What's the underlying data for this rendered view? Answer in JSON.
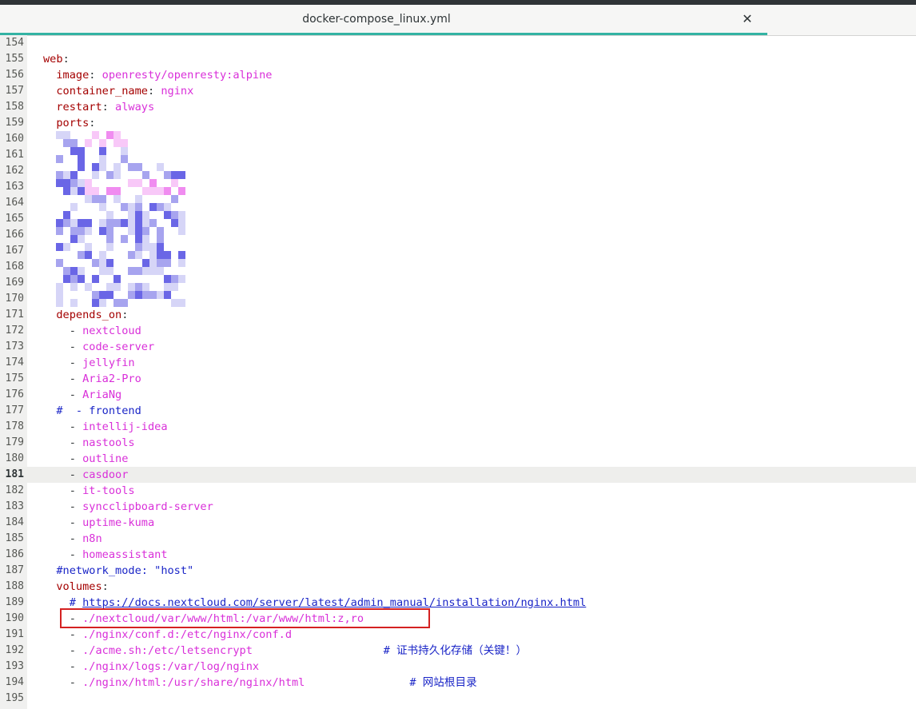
{
  "tab": {
    "title": "docker-compose_linux.yml"
  },
  "current_line": 181,
  "lines": [
    {
      "n": "154",
      "segs": []
    },
    {
      "n": "155",
      "segs": [
        {
          "t": "web",
          "c": "k"
        },
        {
          "t": ":",
          "c": "p"
        }
      ]
    },
    {
      "n": "156",
      "segs": [
        {
          "t": "  image",
          "c": "k"
        },
        {
          "t": ": ",
          "c": "p"
        },
        {
          "t": "openresty/openresty:alpine",
          "c": "v"
        }
      ]
    },
    {
      "n": "157",
      "segs": [
        {
          "t": "  container_name",
          "c": "k"
        },
        {
          "t": ": ",
          "c": "p"
        },
        {
          "t": "nginx",
          "c": "v"
        }
      ]
    },
    {
      "n": "158",
      "segs": [
        {
          "t": "  restart",
          "c": "k"
        },
        {
          "t": ": ",
          "c": "p"
        },
        {
          "t": "always",
          "c": "v"
        }
      ]
    },
    {
      "n": "159",
      "segs": [
        {
          "t": "  ports",
          "c": "k"
        },
        {
          "t": ":",
          "c": "p"
        }
      ]
    },
    {
      "n": "160",
      "segs": []
    },
    {
      "n": "161",
      "segs": []
    },
    {
      "n": "162",
      "segs": []
    },
    {
      "n": "163",
      "segs": []
    },
    {
      "n": "164",
      "segs": []
    },
    {
      "n": "165",
      "segs": []
    },
    {
      "n": "166",
      "segs": []
    },
    {
      "n": "167",
      "segs": []
    },
    {
      "n": "168",
      "segs": []
    },
    {
      "n": "169",
      "segs": []
    },
    {
      "n": "170",
      "segs": []
    },
    {
      "n": "171",
      "segs": [
        {
          "t": "  depends_on",
          "c": "k"
        },
        {
          "t": ":",
          "c": "p"
        }
      ]
    },
    {
      "n": "172",
      "segs": [
        {
          "t": "    - ",
          "c": "p"
        },
        {
          "t": "nextcloud",
          "c": "v"
        }
      ]
    },
    {
      "n": "173",
      "segs": [
        {
          "t": "    - ",
          "c": "p"
        },
        {
          "t": "code-server",
          "c": "v"
        }
      ]
    },
    {
      "n": "174",
      "segs": [
        {
          "t": "    - ",
          "c": "p"
        },
        {
          "t": "jellyfin",
          "c": "v"
        }
      ]
    },
    {
      "n": "175",
      "segs": [
        {
          "t": "    - ",
          "c": "p"
        },
        {
          "t": "Aria2-Pro",
          "c": "v"
        }
      ]
    },
    {
      "n": "176",
      "segs": [
        {
          "t": "    - ",
          "c": "p"
        },
        {
          "t": "AriaNg",
          "c": "v"
        }
      ]
    },
    {
      "n": "177",
      "segs": [
        {
          "t": "  #  - frontend",
          "c": "c"
        }
      ]
    },
    {
      "n": "178",
      "segs": [
        {
          "t": "    - ",
          "c": "p"
        },
        {
          "t": "intellij-idea",
          "c": "v"
        }
      ]
    },
    {
      "n": "179",
      "segs": [
        {
          "t": "    - ",
          "c": "p"
        },
        {
          "t": "nastools",
          "c": "v"
        }
      ]
    },
    {
      "n": "180",
      "segs": [
        {
          "t": "    - ",
          "c": "p"
        },
        {
          "t": "outline",
          "c": "v"
        }
      ]
    },
    {
      "n": "181",
      "segs": [
        {
          "t": "    - ",
          "c": "p"
        },
        {
          "t": "casdoor",
          "c": "v"
        }
      ]
    },
    {
      "n": "182",
      "segs": [
        {
          "t": "    - ",
          "c": "p"
        },
        {
          "t": "it-tools",
          "c": "v"
        }
      ]
    },
    {
      "n": "183",
      "segs": [
        {
          "t": "    - ",
          "c": "p"
        },
        {
          "t": "syncclipboard-server",
          "c": "v"
        }
      ]
    },
    {
      "n": "184",
      "segs": [
        {
          "t": "    - ",
          "c": "p"
        },
        {
          "t": "uptime-kuma",
          "c": "v"
        }
      ]
    },
    {
      "n": "185",
      "segs": [
        {
          "t": "    - ",
          "c": "p"
        },
        {
          "t": "n8n",
          "c": "v"
        }
      ]
    },
    {
      "n": "186",
      "segs": [
        {
          "t": "    - ",
          "c": "p"
        },
        {
          "t": "homeassistant",
          "c": "v"
        }
      ]
    },
    {
      "n": "187",
      "segs": [
        {
          "t": "  #network_mode: \"host\"",
          "c": "c"
        }
      ]
    },
    {
      "n": "188",
      "segs": [
        {
          "t": "  volumes",
          "c": "k"
        },
        {
          "t": ":",
          "c": "p"
        }
      ]
    },
    {
      "n": "189",
      "segs": [
        {
          "t": "    # ",
          "c": "c"
        },
        {
          "t": "https://docs.nextcloud.com/server/latest/admin_manual/installation/nginx.html",
          "c": "u"
        }
      ]
    },
    {
      "n": "190",
      "segs": [
        {
          "t": "    - ",
          "c": "p"
        },
        {
          "t": "./nextcloud/var/www/html:/var/www/html:z,ro",
          "c": "v"
        }
      ]
    },
    {
      "n": "191",
      "segs": [
        {
          "t": "    - ",
          "c": "p"
        },
        {
          "t": "./nginx/conf.d:/etc/nginx/conf.d",
          "c": "v"
        }
      ]
    },
    {
      "n": "192",
      "segs": [
        {
          "t": "    - ",
          "c": "p"
        },
        {
          "t": "./acme.sh:/etc/letsencrypt",
          "c": "v"
        },
        {
          "t": "                    # 证书持久化存储（关键！）",
          "c": "c"
        }
      ]
    },
    {
      "n": "193",
      "segs": [
        {
          "t": "    - ",
          "c": "p"
        },
        {
          "t": "./nginx/logs:/var/log/nginx",
          "c": "v"
        }
      ]
    },
    {
      "n": "194",
      "segs": [
        {
          "t": "    - ",
          "c": "p"
        },
        {
          "t": "./nginx/html:/usr/share/nginx/html",
          "c": "v"
        },
        {
          "t": "                # 网站根目录",
          "c": "c"
        }
      ]
    },
    {
      "n": "195",
      "segs": []
    }
  ]
}
